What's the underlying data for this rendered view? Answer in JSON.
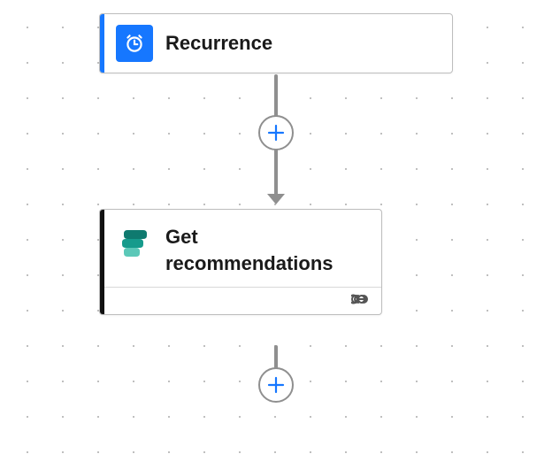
{
  "colors": {
    "trigger_accent": "#1677ff",
    "action_accent": "#111111",
    "connector": "#8f8f8f",
    "plus": "#1677ff"
  },
  "nodes": {
    "trigger": {
      "label": "Recurrence",
      "icon": "clock-icon"
    },
    "action": {
      "label": "Get recommendations",
      "icon": "process-advisor-icon",
      "footer_icon": "link-icon"
    }
  },
  "controls": {
    "add_step_top": "+",
    "add_step_bottom": "+"
  }
}
